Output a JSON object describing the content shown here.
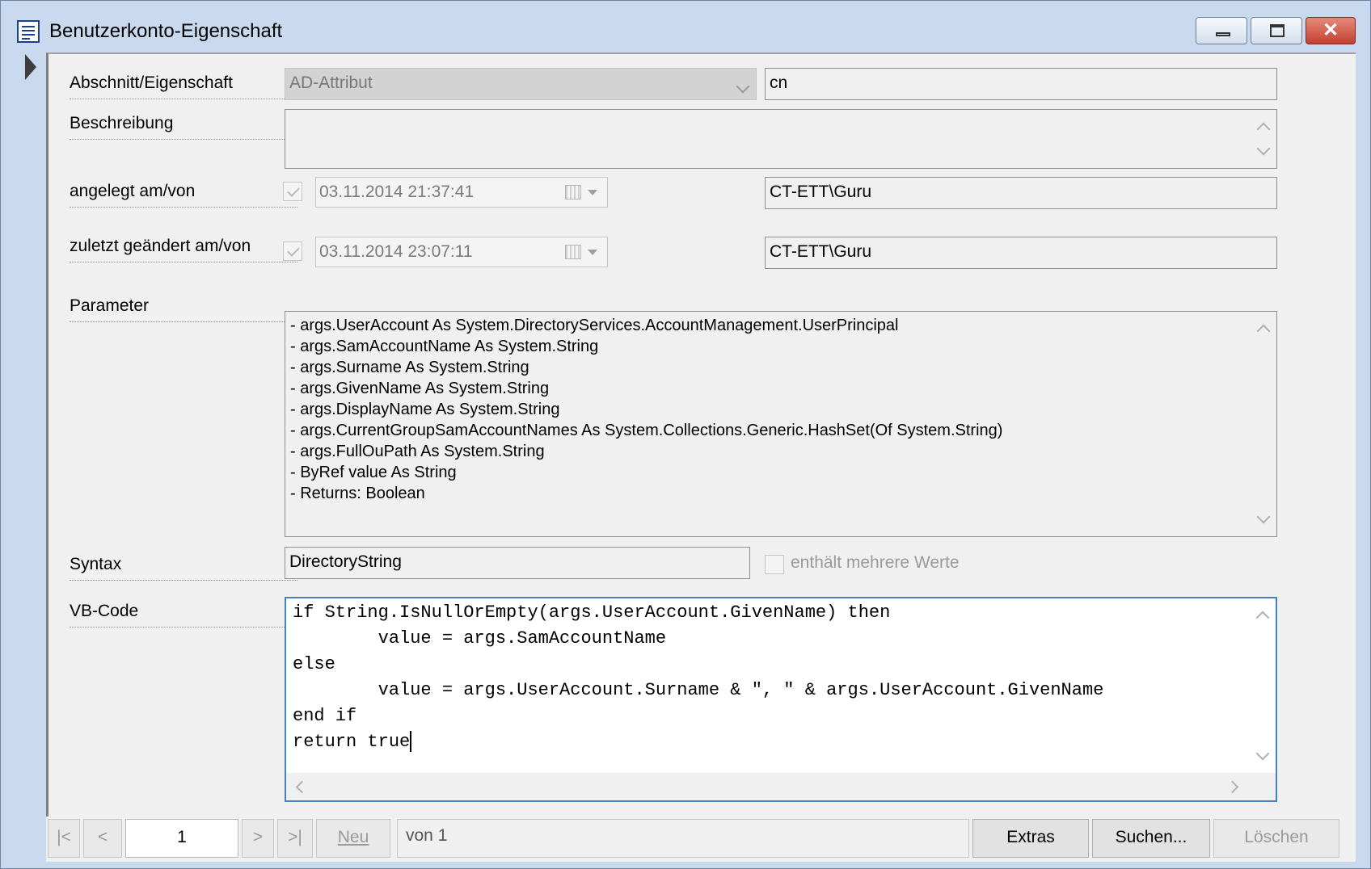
{
  "window": {
    "title": "Benutzerkonto-Eigenschaft",
    "controls": {
      "minimize": "minimize",
      "maximize": "maximize",
      "close": "✕"
    }
  },
  "form": {
    "section_label": "Abschnitt/Eigenschaft",
    "section_combo": "AD-Attribut",
    "property_value": "cn",
    "description_label": "Beschreibung",
    "description_value": "",
    "created_label": "angelegt am/von",
    "created_date": "03.11.2014 21:37:41",
    "created_by": "CT-ETT\\Guru",
    "modified_label": "zuletzt geändert am/von",
    "modified_date": "03.11.2014 23:07:11",
    "modified_by": "CT-ETT\\Guru",
    "parameter_label": "Parameter",
    "parameters": [
      "- args.UserAccount As System.DirectoryServices.AccountManagement.UserPrincipal",
      "- args.SamAccountName As System.String",
      "- args.Surname As System.String",
      "- args.GivenName As System.String",
      "- args.DisplayName As System.String",
      "- args.CurrentGroupSamAccountNames As System.Collections.Generic.HashSet(Of System.String)",
      "- args.FullOuPath As System.String",
      "- ByRef value As String",
      "- Returns: Boolean"
    ],
    "syntax_label": "Syntax",
    "syntax_value": "DirectoryString",
    "multi_value_label": "enthält mehrere Werte",
    "vbcode_label": "VB-Code",
    "vbcode_lines": [
      "if String.IsNullOrEmpty(args.UserAccount.GivenName) then",
      "        value = args.SamAccountName",
      "else",
      "        value = args.UserAccount.Surname & \", \" & args.UserAccount.GivenName",
      "end if",
      "return true"
    ]
  },
  "navigator": {
    "first": "|<",
    "prev": "<",
    "record": "1",
    "next": ">",
    "last": ">|",
    "new": "Neu",
    "of_text": "von 1",
    "extras": "Extras",
    "search": "Suchen...",
    "delete": "Löschen"
  }
}
